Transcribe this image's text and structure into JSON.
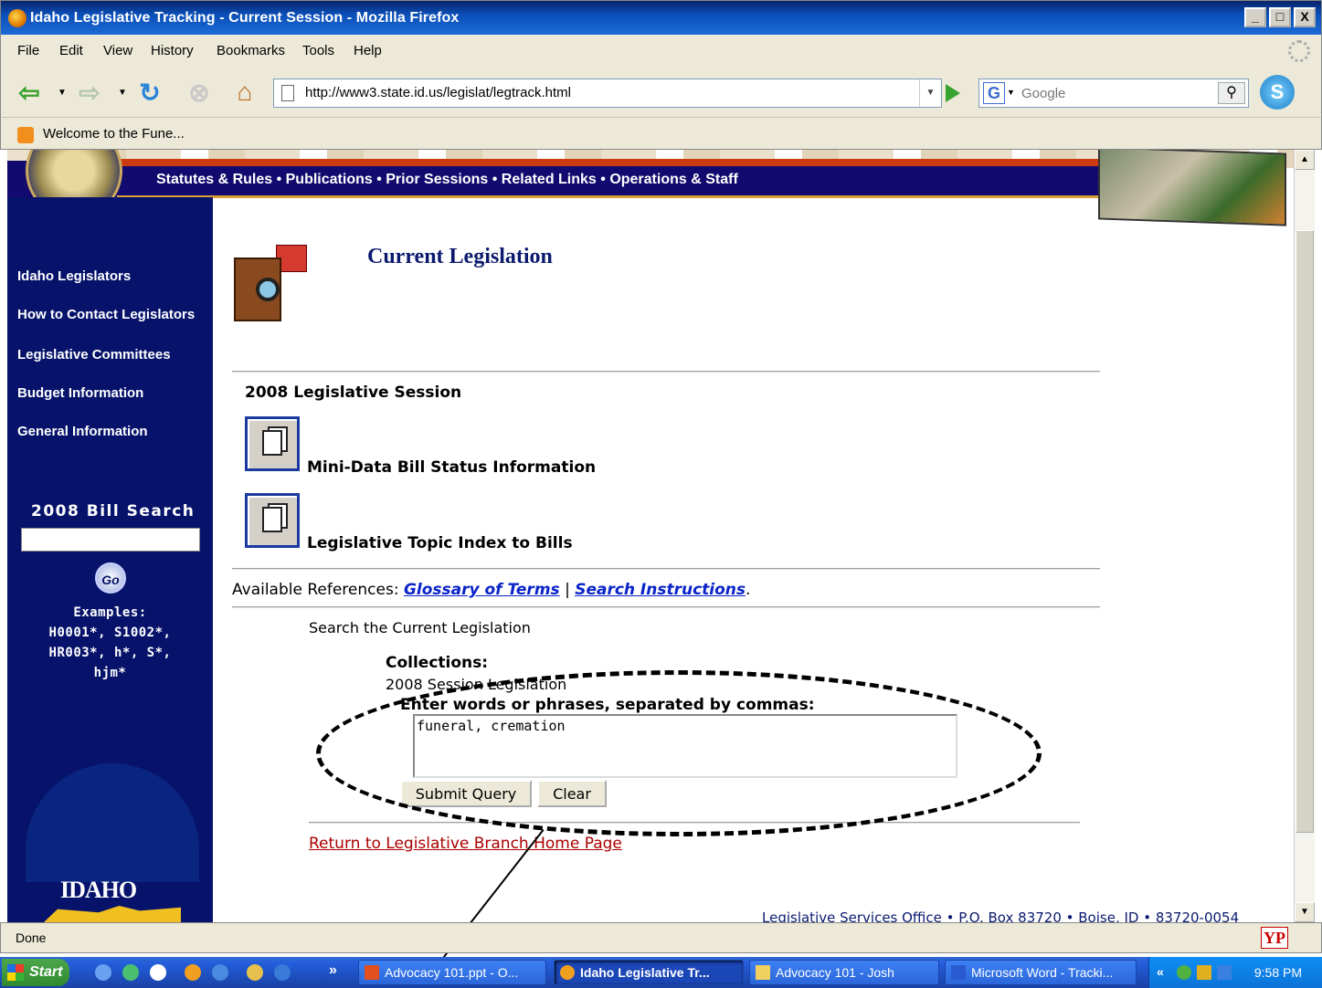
{
  "window": {
    "title": "Idaho Legislative Tracking - Current Session - Mozilla Firefox",
    "minimize": "_",
    "maximize": "□",
    "close": "X"
  },
  "menu": [
    "File",
    "Edit",
    "View",
    "History",
    "Bookmarks",
    "Tools",
    "Help"
  ],
  "nav": {
    "url": "http://www3.state.id.us/legislat/legtrack.html",
    "search_placeholder": "Google",
    "search_engine_letter": "G"
  },
  "bookmarks": [
    "Welcome to the Fune..."
  ],
  "site": {
    "topnav": "Statutes & Rules • Publications • Prior Sessions • Related Links • Operations & Staff",
    "sidebar": {
      "links": [
        "Idaho Legislators",
        "How to Contact Legislators",
        "Legislative Committees",
        "Budget Information",
        "General Information"
      ],
      "bill_search_title": "2008 Bill Search",
      "go_label": "Go",
      "examples_title": "Examples:",
      "examples_lines": [
        "H0001*, S1002*,",
        "HR003*, h*, S*,",
        "hjm*"
      ],
      "idaho_logo": "IDAHO"
    },
    "main": {
      "title": "Current Legislation",
      "session_label": "2008 Legislative Session",
      "links": [
        "Mini-Data Bill Status Information",
        "Legislative Topic Index to Bills"
      ],
      "refs_prefix": "Available References:",
      "refs": [
        "Glossary of Terms",
        "Search Instructions"
      ],
      "refs_sep": "|",
      "refs_end": ".",
      "search_header": "Search the Current Legislation",
      "collections_label": "Collections:",
      "collections_value": "2008 Session Legislation",
      "enter_label": "Enter words or phrases, separated by commas:",
      "query_value": "funeral, cremation",
      "submit_label": "Submit Query",
      "clear_label": "Clear",
      "return_link": "Return to Legislative Branch Home Page",
      "footer": "Legislative Services Office • P.O. Box 83720 • Boise, ID • 83720-0054"
    }
  },
  "status": {
    "text": "Done",
    "yp_label": "YP"
  },
  "taskbar": {
    "start": "Start",
    "chevron": "»",
    "tasks": [
      "Advocacy 101.ppt - O...",
      "Idaho Legislative Tr...",
      "Advocacy 101 - Josh",
      "Microsoft Word - Tracki..."
    ],
    "tray_chevron": "«",
    "clock": "9:58 PM"
  }
}
